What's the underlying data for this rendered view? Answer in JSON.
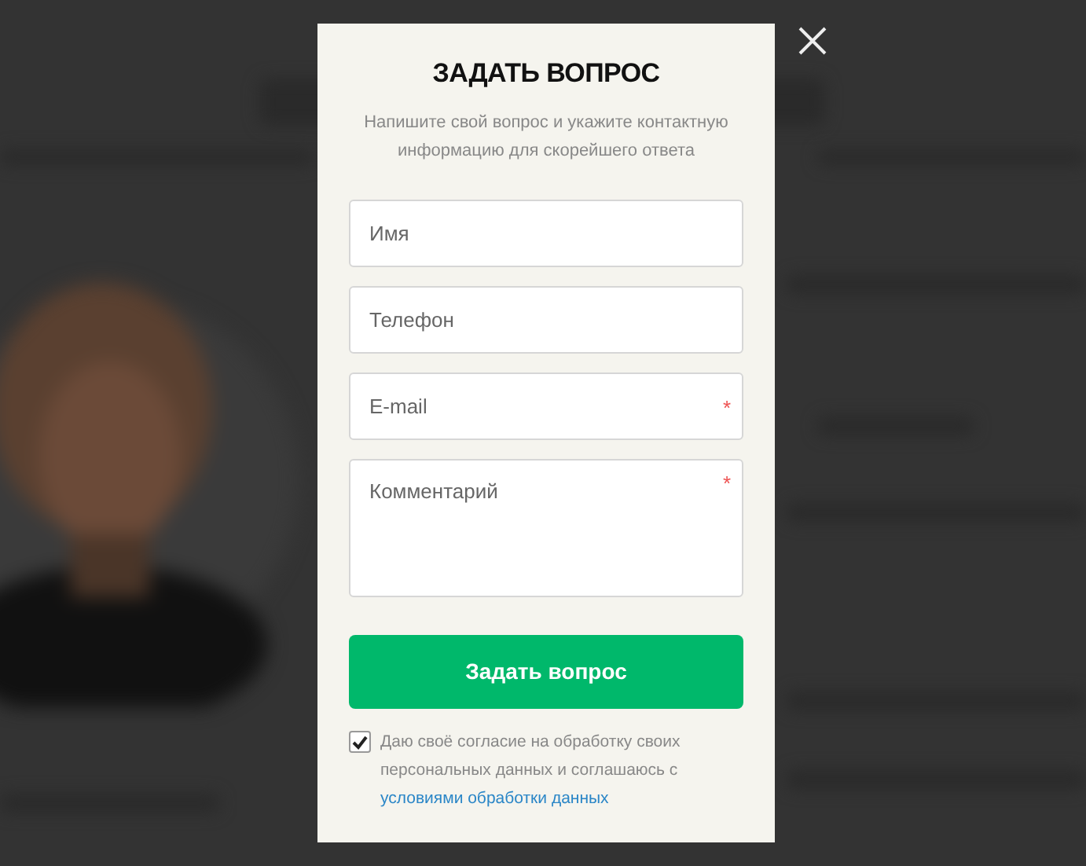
{
  "modal": {
    "title": "ЗАДАТЬ ВОПРОС",
    "subtitle": "Напишите свой вопрос и укажите контактную информацию для скорейшего ответа",
    "fields": [
      {
        "kind": "input",
        "placeholder": "Имя"
      },
      {
        "kind": "input",
        "placeholder": "Телефон"
      },
      {
        "kind": "input",
        "placeholder": "E-mail",
        "required_mark": "*"
      },
      {
        "kind": "textarea",
        "placeholder": "Комментарий",
        "required_mark": "*"
      }
    ],
    "submit": "Задать вопрос",
    "consent": {
      "checked": true,
      "text": "Даю своё согласие на обработку своих персональных данных и соглашаюсь с",
      "link": "условиями обработки данных"
    }
  }
}
